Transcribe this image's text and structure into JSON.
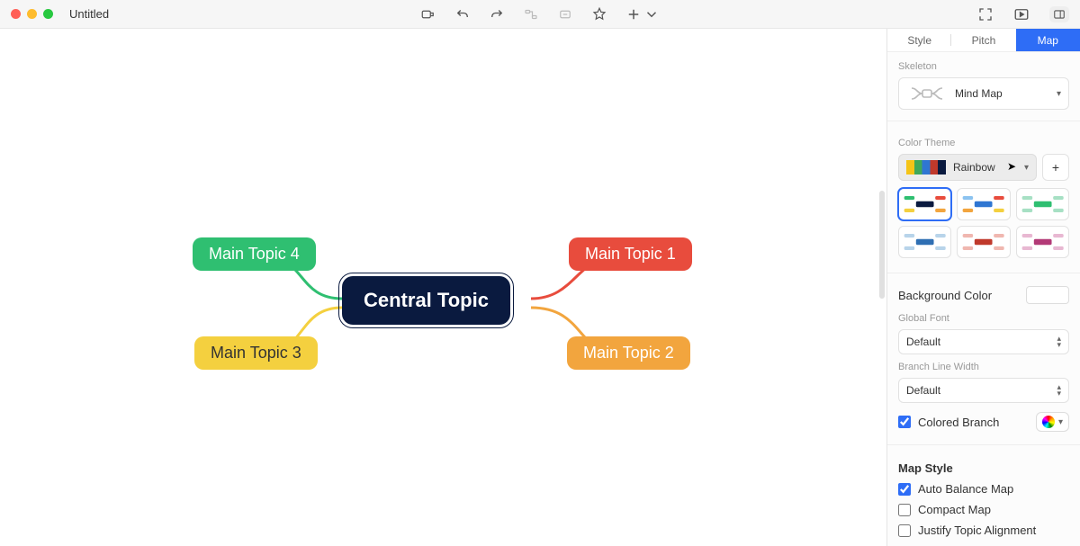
{
  "title": "Untitled",
  "canvas": {
    "central": "Central Topic",
    "topics": {
      "t1": "Main Topic 1",
      "t2": "Main Topic 2",
      "t3": "Main Topic 3",
      "t4": "Main Topic 4"
    }
  },
  "panel": {
    "tabs": {
      "style": "Style",
      "pitch": "Pitch",
      "map": "Map"
    },
    "skeleton": {
      "label": "Skeleton",
      "value": "Mind Map"
    },
    "colorTheme": {
      "label": "Color Theme",
      "value": "Rainbow"
    },
    "bgColor": {
      "label": "Background Color"
    },
    "globalFont": {
      "label": "Global Font",
      "value": "Default"
    },
    "branchWidth": {
      "label": "Branch Line Width",
      "value": "Default"
    },
    "coloredBranch": {
      "label": "Colored Branch",
      "checked": true
    },
    "mapStyle": {
      "heading": "Map Style",
      "autoBalance": {
        "label": "Auto Balance Map",
        "checked": true
      },
      "compact": {
        "label": "Compact Map",
        "checked": false
      },
      "justify": {
        "label": "Justify Topic Alignment",
        "checked": false
      }
    }
  }
}
